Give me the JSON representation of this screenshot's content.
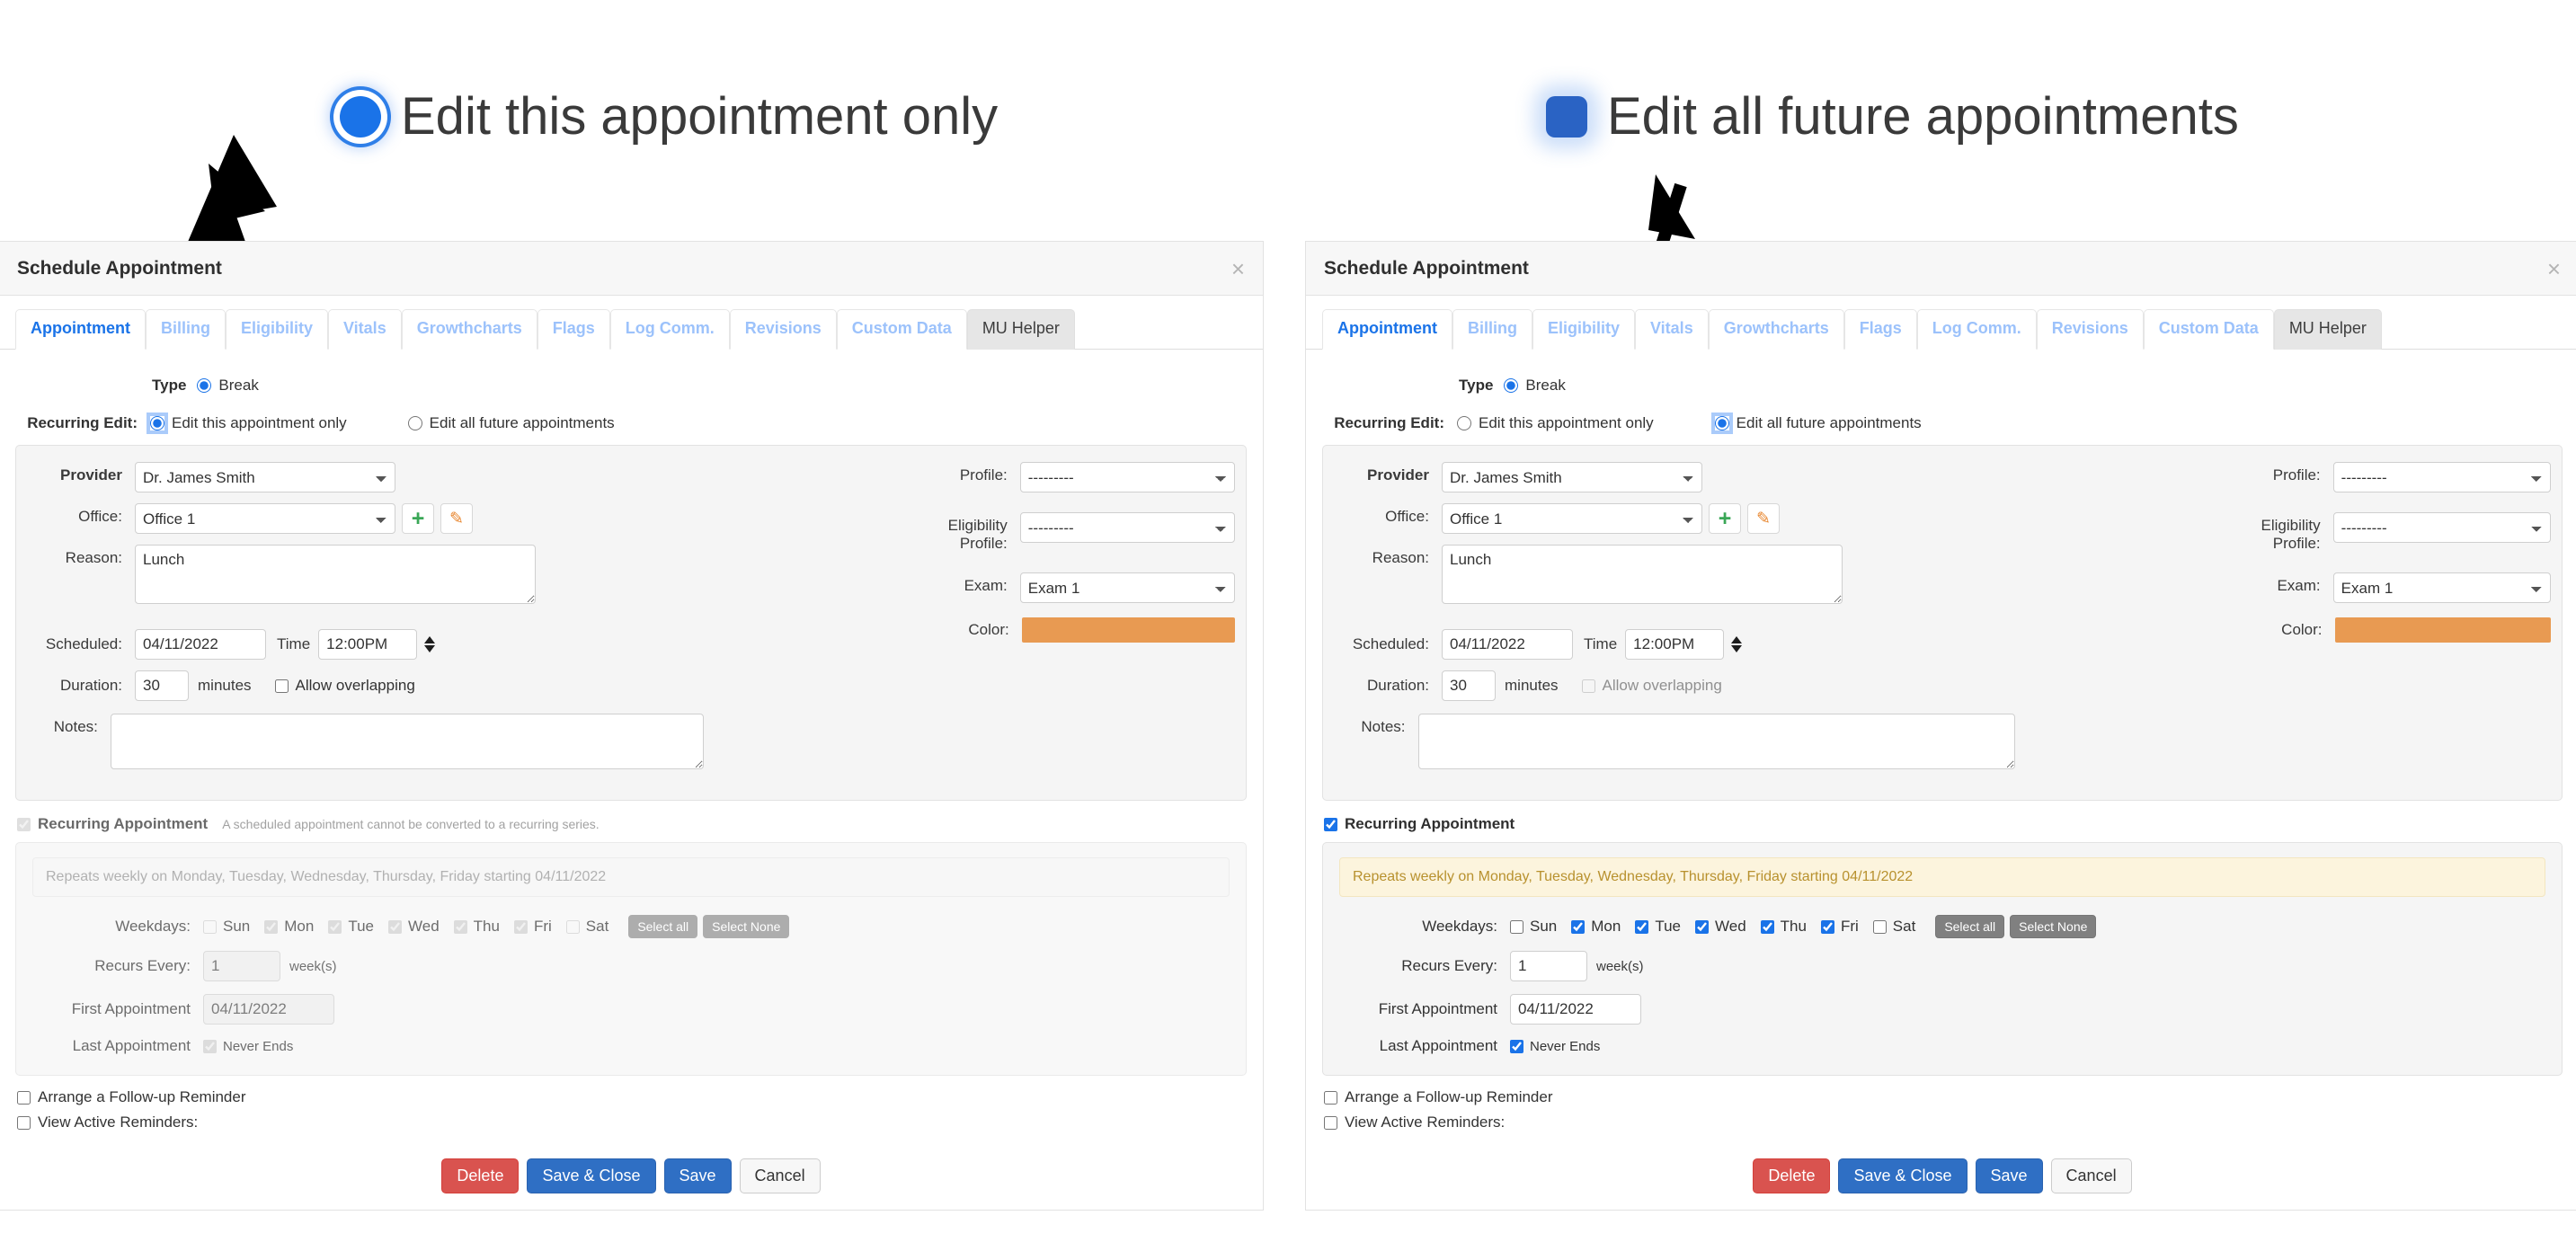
{
  "annotations": {
    "left": {
      "text": "Edit this appointment only",
      "radio_style": "ring",
      "radio_color": "#1a73e8"
    },
    "right": {
      "text": "Edit all future appointments",
      "radio_style": "solid",
      "radio_color": "#2a63c4"
    }
  },
  "dialog": {
    "title": "Schedule Appointment",
    "close_label": "×",
    "tabs": [
      {
        "label": "Appointment",
        "state": "active"
      },
      {
        "label": "Billing",
        "state": "muted"
      },
      {
        "label": "Eligibility",
        "state": "muted"
      },
      {
        "label": "Vitals",
        "state": "muted"
      },
      {
        "label": "Growthcharts",
        "state": "muted"
      },
      {
        "label": "Flags",
        "state": "muted"
      },
      {
        "label": "Log Comm.",
        "state": "muted"
      },
      {
        "label": "Revisions",
        "state": "muted"
      },
      {
        "label": "Custom Data",
        "state": "muted"
      },
      {
        "label": "MU Helper",
        "state": "mu"
      }
    ],
    "type": {
      "label": "Type",
      "option_label": "Break",
      "selected": true
    },
    "recurring_edit": {
      "label": "Recurring Edit:",
      "option_this_only": "Edit this appointment only",
      "option_all_future": "Edit all future appointments"
    },
    "form": {
      "provider_label": "Provider",
      "provider_value": "Dr. James Smith",
      "office_label": "Office:",
      "office_value": "Office 1",
      "add_office_icon": "plus-icon",
      "edit_office_icon": "pencil-icon",
      "reason_label": "Reason:",
      "reason_value": "Lunch",
      "scheduled_label": "Scheduled:",
      "scheduled_date": "04/11/2022",
      "time_label": "Time",
      "time_value": "12:00PM",
      "duration_label": "Duration:",
      "duration_value": "30",
      "minutes_label": "minutes",
      "allow_overlapping_label": "Allow overlapping",
      "allow_overlapping_checked": false,
      "notes_label": "Notes:",
      "notes_value": "",
      "profile_label": "Profile:",
      "profile_value": "---------",
      "eligibility_profile_label": "Eligibility Profile:",
      "eligibility_profile_value": "---------",
      "exam_label": "Exam:",
      "exam_value": "Exam 1",
      "color_label": "Color:",
      "color_value": "#e89a52"
    },
    "recurring": {
      "checkbox_label": "Recurring Appointment",
      "disabled_note": "A scheduled appointment cannot be converted to a recurring series.",
      "banner": "Repeats weekly on Monday, Tuesday, Wednesday, Thursday, Friday starting 04/11/2022",
      "weekdays_label": "Weekdays:",
      "weekdays": [
        {
          "label": "Sun",
          "checked": false
        },
        {
          "label": "Mon",
          "checked": true
        },
        {
          "label": "Tue",
          "checked": true
        },
        {
          "label": "Wed",
          "checked": true
        },
        {
          "label": "Thu",
          "checked": true
        },
        {
          "label": "Fri",
          "checked": true
        },
        {
          "label": "Sat",
          "checked": false
        }
      ],
      "select_all_label": "Select all",
      "select_none_label": "Select None",
      "recurs_every_label": "Recurs Every:",
      "recurs_every_value": "1",
      "weeks_label": "week(s)",
      "first_appointment_label": "First Appointment",
      "first_appointment_value": "04/11/2022",
      "last_appointment_label": "Last Appointment",
      "never_ends_label": "Never Ends",
      "never_ends_checked": true
    },
    "bottom": {
      "arrange_followup_label": "Arrange a Follow-up Reminder",
      "view_active_reminders_label": "View Active Reminders:"
    },
    "buttons": {
      "delete": "Delete",
      "save_close": "Save & Close",
      "save": "Save",
      "cancel": "Cancel"
    }
  }
}
